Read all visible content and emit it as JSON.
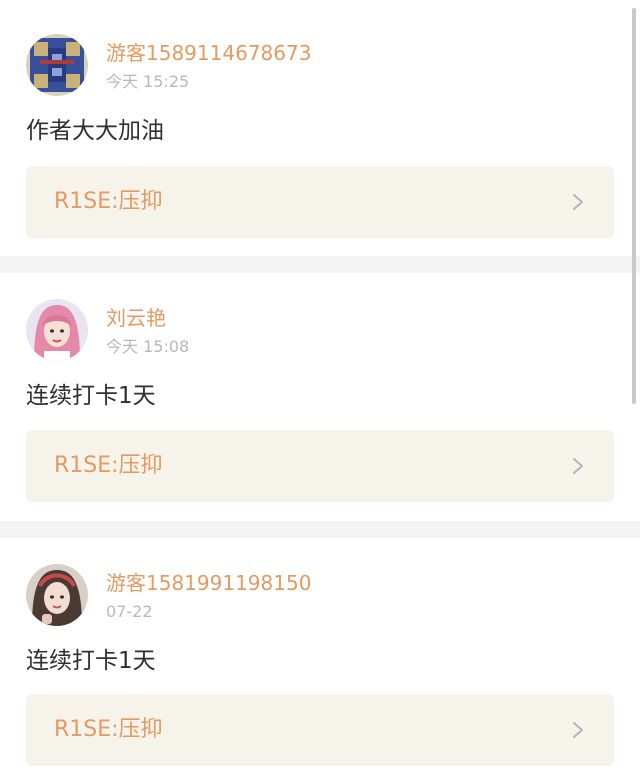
{
  "posts": [
    {
      "username": "游客1589114678673",
      "time": "今天 15:25",
      "content": "作者大大加油",
      "work_title": "R1SE:压抑",
      "avatar_icon": "pixel-art-avatar-icon"
    },
    {
      "username": "刘云艳",
      "time": "今天 15:08",
      "content": "连续打卡1天",
      "work_title": "R1SE:压抑",
      "avatar_icon": "pink-hair-girl-avatar-icon"
    },
    {
      "username": "游客1581991198150",
      "time": "07-22",
      "content": "连续打卡1天",
      "work_title": "R1SE:压抑",
      "avatar_icon": "girl-photo-avatar-icon"
    }
  ],
  "colors": {
    "accent": "#e49a60",
    "link_bg": "#f5f3ea",
    "separator": "#f3f3f3",
    "time_text": "#b8b8b8",
    "body_text": "#2f2f2f"
  }
}
